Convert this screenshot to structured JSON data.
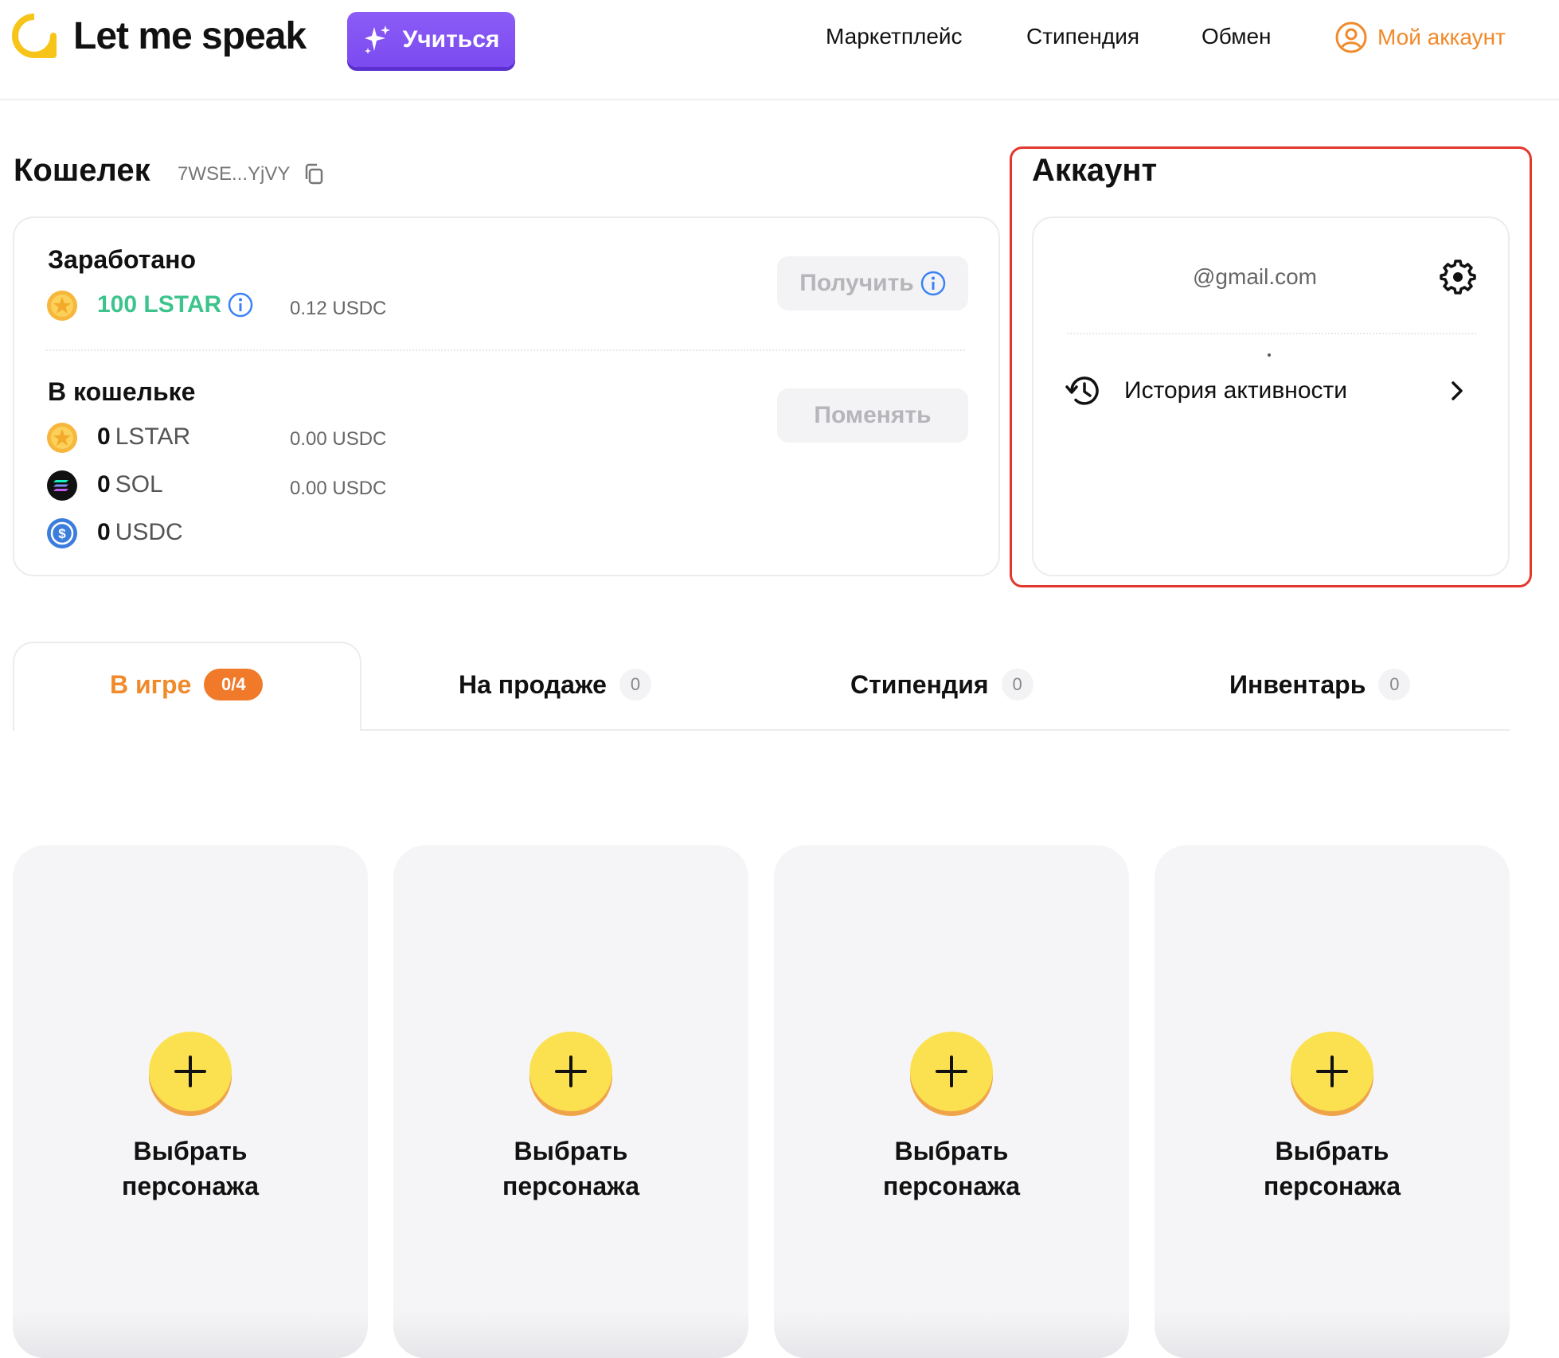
{
  "header": {
    "brand": "Let me speak",
    "learn_button": "Учиться",
    "nav": {
      "marketplace": "Маркетплейс",
      "scholarship": "Стипендия",
      "exchange": "Обмен",
      "account": "Мой аккаунт"
    }
  },
  "wallet": {
    "title": "Кошелек",
    "address": "7WSE...YjVY",
    "earned": {
      "title": "Заработано",
      "amount": "100 LSTAR",
      "usdc": "0.12 USDC",
      "claim_button": "Получить"
    },
    "in_wallet": {
      "title": "В кошельке",
      "swap_button": "Поменять",
      "assets": [
        {
          "amount": "0",
          "currency": "LSTAR",
          "usdc": "0.00 USDC"
        },
        {
          "amount": "0",
          "currency": "SOL",
          "usdc": "0.00 USDC"
        },
        {
          "amount": "0",
          "currency": "USDC",
          "usdc": ""
        }
      ]
    }
  },
  "account": {
    "title": "Аккаунт",
    "email": "@gmail.com",
    "history_label": "История активности"
  },
  "tabs": [
    {
      "label": "В игре",
      "badge": "0/4",
      "active": true
    },
    {
      "label": "На продаже",
      "badge": "0",
      "active": false
    },
    {
      "label": "Стипендия",
      "badge": "0",
      "active": false
    },
    {
      "label": "Инвентарь",
      "badge": "0",
      "active": false
    }
  ],
  "slots": [
    {
      "label_line1": "Выбрать",
      "label_line2": "персонажа"
    },
    {
      "label_line1": "Выбрать",
      "label_line2": "персонажа"
    },
    {
      "label_line1": "Выбрать",
      "label_line2": "персонажа"
    },
    {
      "label_line1": "Выбрать",
      "label_line2": "персонажа"
    }
  ],
  "colors": {
    "accent_orange": "#f08a2a",
    "learn_purple": "#8b5cf6",
    "lstar_green": "#3cc48c",
    "highlight_red": "#e3362c",
    "plus_yellow": "#fbe14f"
  },
  "icons": [
    "logo-mark-icon",
    "sparkle-icon",
    "user-circle-icon",
    "copy-icon",
    "lstar-coin-icon",
    "info-icon",
    "sol-coin-icon",
    "usdc-coin-icon",
    "gear-icon",
    "history-icon",
    "chevron-right-icon",
    "plus-icon"
  ]
}
